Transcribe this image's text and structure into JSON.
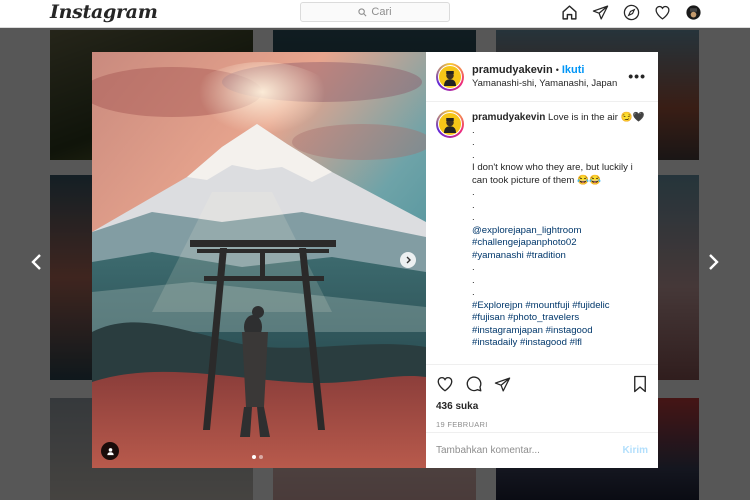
{
  "nav": {
    "logo": "Instagram",
    "search_placeholder": "Cari",
    "icons": [
      "home-icon",
      "direct-icon",
      "explore-icon",
      "heart-icon",
      "profile-avatar"
    ]
  },
  "post": {
    "username": "pramudyakevin",
    "separator": "•",
    "follow": "Ikuti",
    "location": "Yamanashi-shi, Yamanashi, Japan",
    "more": "•••",
    "caption_first": "Love is in the air 😏🖤",
    "caption_lines": [
      ".",
      ".",
      ".",
      "I don't know who they are, but luckily i can took picture of them 😂😂",
      ".",
      ".",
      ".",
      "@explorejapan_lightroom",
      "#challengejapanphoto02",
      "#yamanashi #tradition",
      ".",
      ".",
      ".",
      "#Explorejpn #mountfuji #fujidelic",
      "#fujisan #photo_travelers",
      "#instagramjapan #instagood",
      "#instadaily #instagood #lfl"
    ],
    "likes": "436 suka",
    "date": "19 FEBRUARI",
    "comment_placeholder": "Tambahkan komentar...",
    "post_button": "Kirim"
  },
  "colors": {
    "accent": "#0095f6",
    "hashtag": "#00376b",
    "post_disabled": "#b2dffc"
  }
}
